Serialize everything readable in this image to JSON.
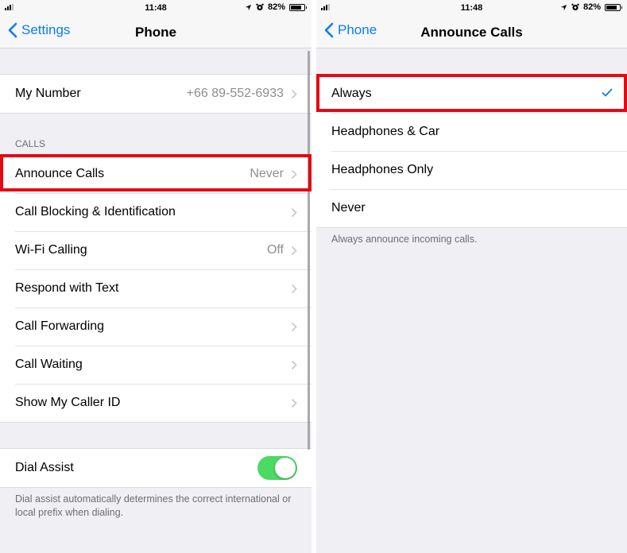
{
  "left_screen": {
    "status_bar": {
      "time": "11:48",
      "battery": "82%",
      "battery_level": 0.82
    },
    "nav": {
      "back_label": "Settings",
      "title": "Phone"
    },
    "my_number": {
      "label": "My Number",
      "value": "+66 89-552-6933"
    },
    "calls_section": {
      "header": "CALLS",
      "items": [
        {
          "label": "Announce Calls",
          "value": "Never"
        },
        {
          "label": "Call Blocking & Identification",
          "value": ""
        },
        {
          "label": "Wi-Fi Calling",
          "value": "Off"
        },
        {
          "label": "Respond with Text",
          "value": ""
        },
        {
          "label": "Call Forwarding",
          "value": ""
        },
        {
          "label": "Call Waiting",
          "value": ""
        },
        {
          "label": "Show My Caller ID",
          "value": ""
        }
      ]
    },
    "dial_assist": {
      "label": "Dial Assist",
      "enabled": true,
      "footer": "Dial assist automatically determines the correct international or local prefix when dialing."
    }
  },
  "right_screen": {
    "status_bar": {
      "time": "11:48",
      "battery": "82%",
      "battery_level": 0.82
    },
    "nav": {
      "back_label": "Phone",
      "title": "Announce Calls"
    },
    "options": [
      {
        "label": "Always",
        "selected": true
      },
      {
        "label": "Headphones & Car",
        "selected": false
      },
      {
        "label": "Headphones Only",
        "selected": false
      },
      {
        "label": "Never",
        "selected": false
      }
    ],
    "footer": "Always announce incoming calls."
  },
  "colors": {
    "accent": "#0a7aff",
    "toggle_on": "#4cd964",
    "highlight": "#e50914",
    "background": "#efeff4"
  }
}
